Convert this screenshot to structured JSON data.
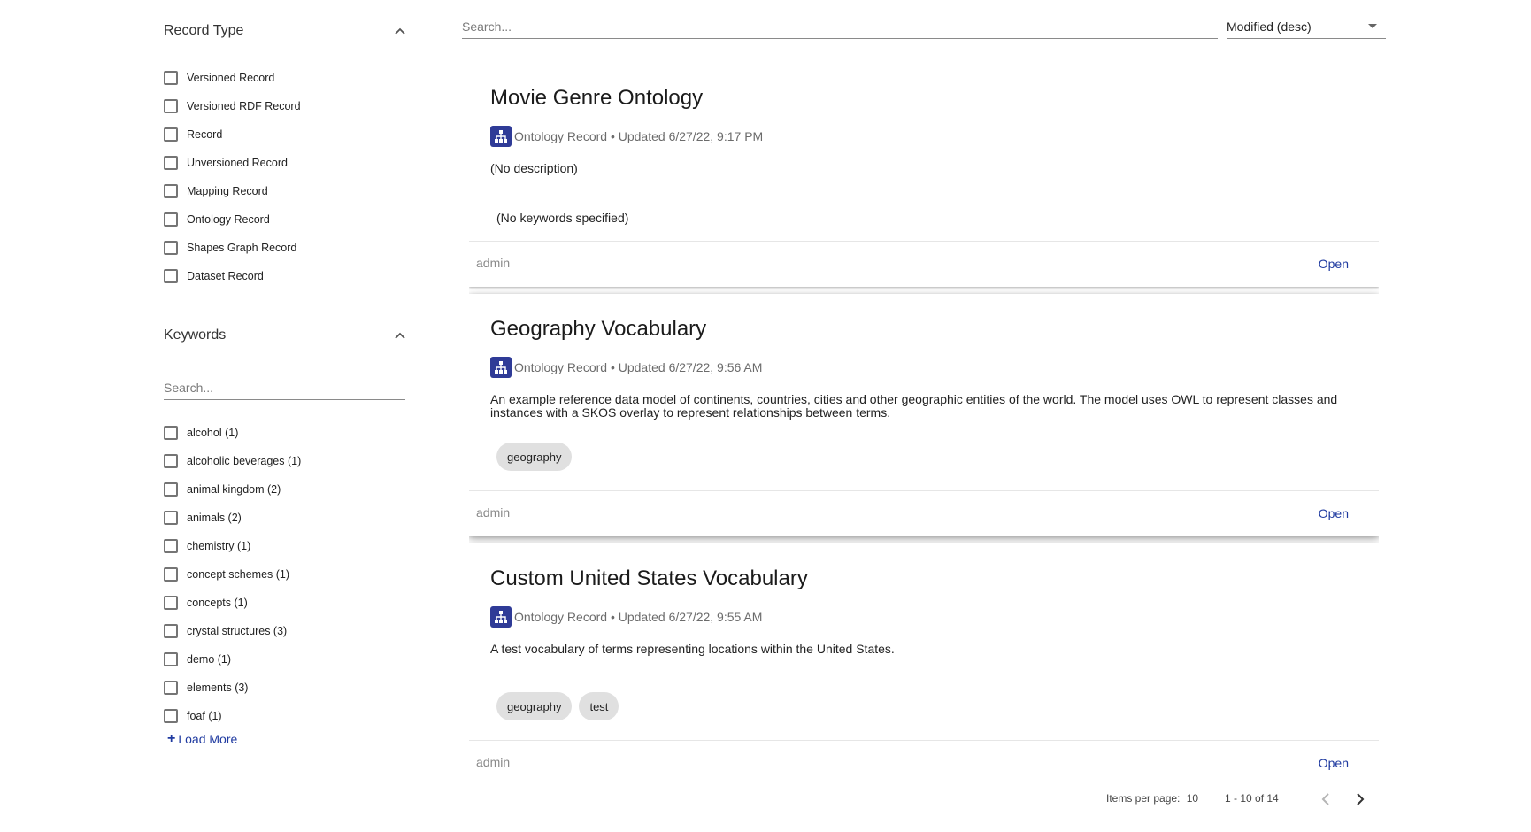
{
  "search": {
    "placeholder": "Search..."
  },
  "sort": {
    "value": "Modified (desc)"
  },
  "filters": {
    "record_type": {
      "title": "Record Type",
      "items": [
        {
          "label": "Versioned Record"
        },
        {
          "label": "Versioned RDF Record"
        },
        {
          "label": "Record"
        },
        {
          "label": "Unversioned Record"
        },
        {
          "label": "Mapping Record"
        },
        {
          "label": "Ontology Record"
        },
        {
          "label": "Shapes Graph Record"
        },
        {
          "label": "Dataset Record"
        }
      ]
    },
    "keywords": {
      "title": "Keywords",
      "search_placeholder": "Search...",
      "items": [
        {
          "label": "alcohol (1)"
        },
        {
          "label": "alcoholic beverages (1)"
        },
        {
          "label": "animal kingdom (2)"
        },
        {
          "label": "animals (2)"
        },
        {
          "label": "chemistry (1)"
        },
        {
          "label": "concept schemes (1)"
        },
        {
          "label": "concepts (1)"
        },
        {
          "label": "crystal structures (3)"
        },
        {
          "label": "demo (1)"
        },
        {
          "label": "elements (3)"
        },
        {
          "label": "foaf (1)"
        }
      ],
      "load_more": "Load More"
    }
  },
  "records": [
    {
      "title": "Movie Genre Ontology",
      "type": "Ontology Record",
      "updated": " • Updated 6/27/22, 9:17 PM",
      "description": "(No description)",
      "no_keywords": "(No keywords specified)",
      "keywords": [],
      "owner": "admin",
      "open_label": "Open"
    },
    {
      "title": "Geography Vocabulary",
      "type": "Ontology Record",
      "updated": " • Updated 6/27/22, 9:56 AM",
      "description": "An example reference data model of continents, countries, cities and other geographic entities of the world. The model uses OWL to represent classes and instances with a SKOS overlay to represent relationships between terms.",
      "keywords": [
        "geography"
      ],
      "owner": "admin",
      "open_label": "Open"
    },
    {
      "title": "Custom United States Vocabulary",
      "type": "Ontology Record",
      "updated": " • Updated 6/27/22, 9:55 AM",
      "description": "A test vocabulary of terms representing locations within the United States.",
      "keywords": [
        "geography",
        "test"
      ],
      "owner": "admin",
      "open_label": "Open"
    }
  ],
  "paginator": {
    "items_per_page_label": "Items per page:",
    "items_per_page": "10",
    "range": "1 - 10 of 14"
  },
  "icons": {
    "record_type": "ontology-hierarchy-icon",
    "prev": "chevron-left-icon",
    "next": "chevron-right-icon",
    "collapse": "chevron-up-icon"
  },
  "colors": {
    "accent": "#1f3aa0",
    "record_icon_bg": "#2f3b97",
    "chip_bg": "#e0e0e0"
  }
}
